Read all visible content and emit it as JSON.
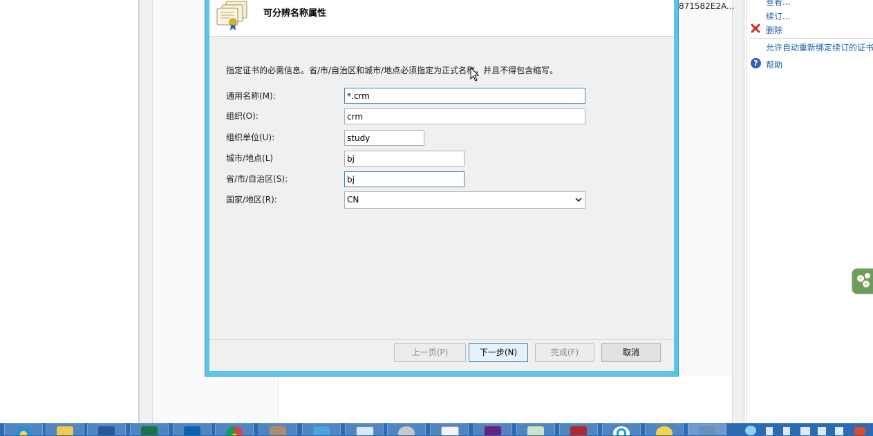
{
  "background": {
    "cert_hash": "871582E2A...",
    "actions": {
      "view": "查看...",
      "renew": "续订...",
      "delete": "删除",
      "auto_rebind": "允许自动重新绑定续订的证书",
      "help": "帮助"
    }
  },
  "dialog": {
    "title": "可分辨名称属性",
    "instruction": "指定证书的必需信息。省/市/自治区和城市/地点必须指定为正式名称，并且不得包含缩写。",
    "fields": {
      "common_name": {
        "label": "通用名称(M):",
        "value": "*.crm"
      },
      "organization": {
        "label": "组织(O):",
        "value": "crm"
      },
      "org_unit": {
        "label": "组织单位(U):",
        "value": "study"
      },
      "city": {
        "label": "城市/地点(L)",
        "value": "bj"
      },
      "state": {
        "label": "省/市/自治区(S):",
        "value": "bj"
      },
      "country": {
        "label": "国家/地区(R):",
        "value": "CN"
      }
    },
    "buttons": {
      "prev": "上一页(P)",
      "next": "下一步(N)",
      "finish": "完成(F)",
      "cancel": "取消"
    }
  },
  "colors": {
    "dialog_frame": "#5cc4ea",
    "taskbar": "#2c6ab3",
    "link": "#1b5ea8"
  },
  "taskbar": {
    "apps": [
      "ie-icon",
      "explorer-icon",
      "word-icon",
      "excel-icon",
      "outlook-icon",
      "chrome-icon",
      "toolbox-icon",
      "qq-icon",
      "window-icon",
      "tool-icon",
      "document-icon",
      "visual-studio-icon",
      "notes-icon",
      "book-icon",
      "network-icon",
      "messenger-icon",
      "virtualbox-icon"
    ]
  }
}
